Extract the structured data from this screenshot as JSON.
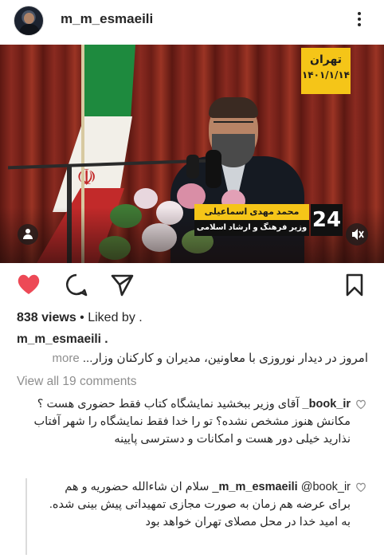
{
  "header": {
    "username": "m_m_esmaeili",
    "more_icon": "more-vertical-icon"
  },
  "media": {
    "location": "تهران",
    "date": "۱۴۰۱/۱/۱۴",
    "speaker_name": "محمد مهدی اسماعیلی",
    "speaker_title": "وزیر فرهنگ و ارشاد اسلامی",
    "channel": "24",
    "tag_icon": "user-tag-icon",
    "sound_icon": "muted-speaker-icon"
  },
  "actions": {
    "like_icon": "heart-filled-icon",
    "comment_icon": "comment-icon",
    "share_icon": "send-icon",
    "save_icon": "bookmark-icon",
    "like_color": "#ed4956"
  },
  "post": {
    "views": "838 views",
    "liked_by": " • Liked by .",
    "caption_user": "m_m_esmaeili .",
    "caption_text": "امروز در دیدار نوروزی با معاونین، مدیران و کارکنان وزار...",
    "caption_more": "more",
    "view_all_comments": "View all 19 comments"
  },
  "comments": [
    {
      "handle": "book_ir_",
      "text": "آقای وزیر ببخشید نمایشگاه کتاب فقط حضوری هست ؟ مکانش هنوز مشخص نشده؟ تو را خدا فقط نمایشگاه را شهر آفتاب نذارید خیلی دور هست و امکانات و دسترسی پایینه"
    },
    {
      "handle": "m_m_esmaeili",
      "mention": "@book_ir_",
      "text": "سلام ان شاءالله حضوریه و هم برای عرضه هم زمان به صورت مجازی تمهیداتی پیش بینی شده. به امید خدا در محل مصلای تهران خواهد بود"
    }
  ]
}
